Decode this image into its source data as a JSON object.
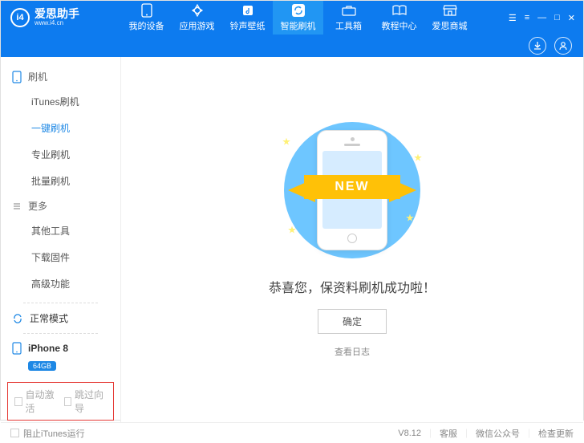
{
  "brand": {
    "name": "爱思助手",
    "url": "www.i4.cn",
    "logo_inner": "i4"
  },
  "nav": {
    "items": [
      {
        "label": "我的设备",
        "icon": "phone"
      },
      {
        "label": "应用游戏",
        "icon": "app"
      },
      {
        "label": "铃声壁纸",
        "icon": "music"
      },
      {
        "label": "智能刷机",
        "icon": "sync",
        "active": true
      },
      {
        "label": "工具箱",
        "icon": "toolbox"
      },
      {
        "label": "教程中心",
        "icon": "book"
      },
      {
        "label": "爱思商城",
        "icon": "store"
      }
    ]
  },
  "sidebar": {
    "section1_label": "刷机",
    "items1": [
      {
        "label": "iTunes刷机"
      },
      {
        "label": "一键刷机",
        "active": true
      },
      {
        "label": "专业刷机"
      },
      {
        "label": "批量刷机"
      }
    ],
    "section2_label": "更多",
    "items2": [
      {
        "label": "其他工具"
      },
      {
        "label": "下载固件"
      },
      {
        "label": "高级功能"
      }
    ],
    "mode_label": "正常模式",
    "device_name": "iPhone 8",
    "device_badge": "64GB",
    "bottom_opts": [
      {
        "label": "自动激活"
      },
      {
        "label": "跳过向导"
      }
    ]
  },
  "main": {
    "ribbon_text": "NEW",
    "title": "恭喜您，保资料刷机成功啦！",
    "ok_label": "确定",
    "log_link": "查看日志"
  },
  "footer": {
    "prevent_itunes": "阻止iTunes运行",
    "version": "V8.12",
    "links": [
      "客服",
      "微信公众号",
      "检查更新"
    ]
  }
}
